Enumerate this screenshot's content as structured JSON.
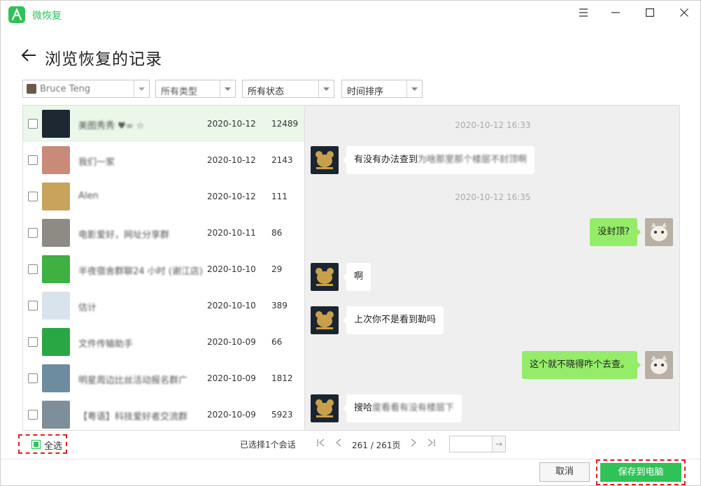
{
  "app": {
    "title": "微恢复",
    "accent": "#2fc257",
    "icons": [
      "menu-icon",
      "minimize-icon",
      "maximize-icon",
      "close-icon"
    ]
  },
  "header": {
    "title": "浏览恢复的记录"
  },
  "filters": {
    "contact": "Bruce Teng",
    "type": "所有类型",
    "status": "所有状态",
    "sort": "时间排序"
  },
  "conversations": [
    {
      "name": "美图秀秀 ♥∞ ☆",
      "date": "2020-10-12",
      "count": "12489",
      "selected": true,
      "avatar_color": "#1d2833"
    },
    {
      "name": "我们一家",
      "date": "2020-10-12",
      "count": "2143",
      "selected": false,
      "avatar_color": "#c98a7a"
    },
    {
      "name": "Alen",
      "date": "2020-10-12",
      "count": "111",
      "selected": false,
      "avatar_color": "#c9a25b"
    },
    {
      "name": "电影爱好，网址分享群",
      "date": "2020-10-11",
      "count": "86",
      "selected": false,
      "avatar_color": "#8e8a84"
    },
    {
      "name": "半夜宿舍群聊24 小时 (谢江店)",
      "date": "2020-10-10",
      "count": "29",
      "selected": false,
      "avatar_color": "#3fb041"
    },
    {
      "name": "估计",
      "date": "2020-10-10",
      "count": "389",
      "selected": false,
      "avatar_color": "#d9e3ec"
    },
    {
      "name": "文件传输助手",
      "date": "2020-10-09",
      "count": "66",
      "selected": false,
      "avatar_color": "#2aa745"
    },
    {
      "name": "明星周边比丝活动报名群广",
      "date": "2020-10-09",
      "count": "1812",
      "selected": false,
      "avatar_color": "#6d8ca0"
    },
    {
      "name": "【粤语】科技爱好者交流群",
      "date": "2020-10-09",
      "count": "5923",
      "selected": false,
      "avatar_color": "#7e8f9a"
    }
  ],
  "footer_left": {
    "select_all": "全选",
    "selected_info": "已选择1个会话"
  },
  "messages": [
    {
      "kind": "time",
      "text": "2020-10-12 16:33"
    },
    {
      "kind": "in",
      "text": "有没有办法查到",
      "blurred": "为啥那里那个楼层不封顶啊"
    },
    {
      "kind": "time",
      "text": "2020-10-12 16:35"
    },
    {
      "kind": "out",
      "text": "没封顶?"
    },
    {
      "kind": "in",
      "text": "啊",
      "blurred": ""
    },
    {
      "kind": "in",
      "text": "上次你不是看到勒吗",
      "blurred": ""
    },
    {
      "kind": "out",
      "text": "这个就不晓得咋个去查。"
    },
    {
      "kind": "in",
      "text": "搜哈",
      "blurred": "度看看有没有楼层下"
    }
  ],
  "pager": {
    "page_text": "261 / 261页",
    "go": "→"
  },
  "buttons": {
    "cancel": "取消",
    "save": "保存到电脑"
  }
}
